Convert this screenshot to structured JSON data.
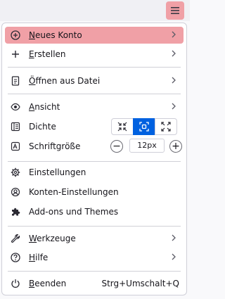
{
  "toolbar": {
    "menu_icon": "hamburger-icon",
    "highlight_color": "#f0a0a6"
  },
  "menu": {
    "new_account": {
      "label_key": "N",
      "label_rest": "eues Konto",
      "icon": "plus-circle-icon"
    },
    "create": {
      "label_key": "E",
      "label_rest": "rstellen",
      "icon": "plus-icon"
    },
    "open_file": {
      "label_key": "Ö",
      "label_rest": "ffnen aus Datei",
      "icon": "file-icon"
    },
    "view": {
      "label_key": "A",
      "label_rest": "nsicht",
      "icon": "eye-icon"
    },
    "density": {
      "label": "Dichte",
      "icon": "density-icon",
      "options": [
        "compact",
        "normal",
        "touch"
      ],
      "active": "normal",
      "active_color": "#0061e0"
    },
    "font_size": {
      "label": "Schriftgröße",
      "icon": "font-size-icon",
      "value": "12px",
      "decrease_symbol": "−",
      "increase_symbol": "+"
    },
    "settings": {
      "label": "Einstellungen",
      "icon": "gear-icon"
    },
    "account_settings": {
      "label": "Konten-Einstellungen",
      "icon": "account-icon"
    },
    "addons": {
      "label": "Add-ons und Themes",
      "icon": "puzzle-icon"
    },
    "tools": {
      "label_key": "W",
      "label_rest": "erkzeuge",
      "icon": "wrench-icon"
    },
    "help": {
      "label_key": "H",
      "label_rest": "ilfe",
      "icon": "help-icon"
    },
    "quit": {
      "label_key": "B",
      "label_rest": "eenden",
      "shortcut": "Strg+Umschalt+Q",
      "icon": "power-icon"
    }
  }
}
